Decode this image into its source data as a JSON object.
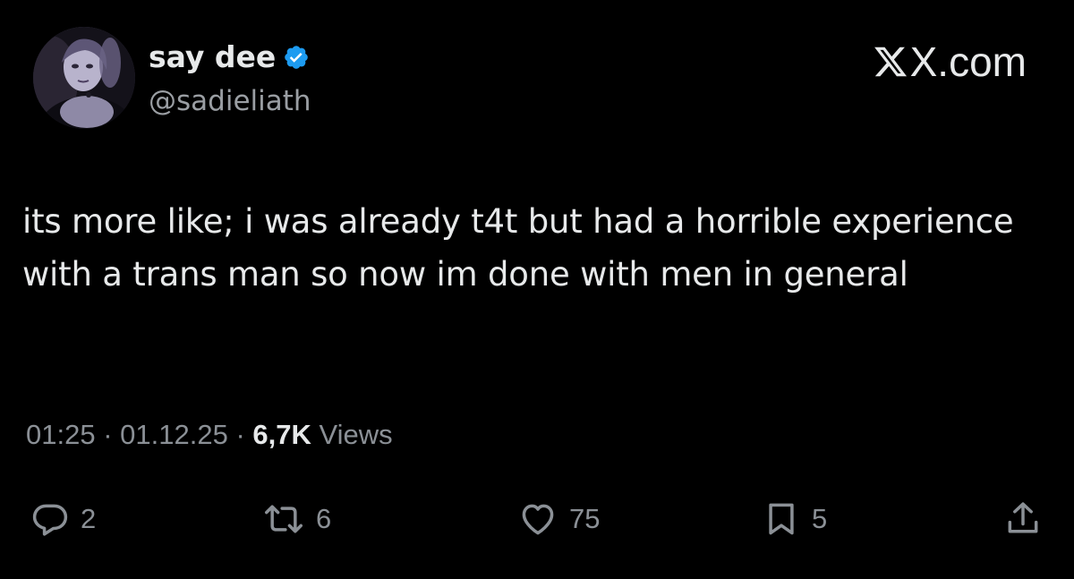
{
  "author": {
    "display_name": "say dee",
    "handle": "@sadieliath",
    "verified": true,
    "verified_color": "#1d9bf0"
  },
  "brand": {
    "text": "X.com"
  },
  "tweet": {
    "text": "its more like; i was already t4t but had a horrible experience with a trans man so now im done with men in general",
    "time": "01:25",
    "date": "01.12.25",
    "separator": "·",
    "views_count": "6,7K",
    "views_label": "Views"
  },
  "actions": {
    "replies": "2",
    "reposts": "6",
    "likes": "75",
    "bookmarks": "5"
  },
  "icons": {
    "reply": "reply-icon",
    "repost": "repost-icon",
    "like": "heart-icon",
    "bookmark": "bookmark-icon",
    "share": "share-icon"
  },
  "colors": {
    "background": "#000000",
    "text_primary": "#e7e9ea",
    "text_secondary": "#8b9096"
  }
}
